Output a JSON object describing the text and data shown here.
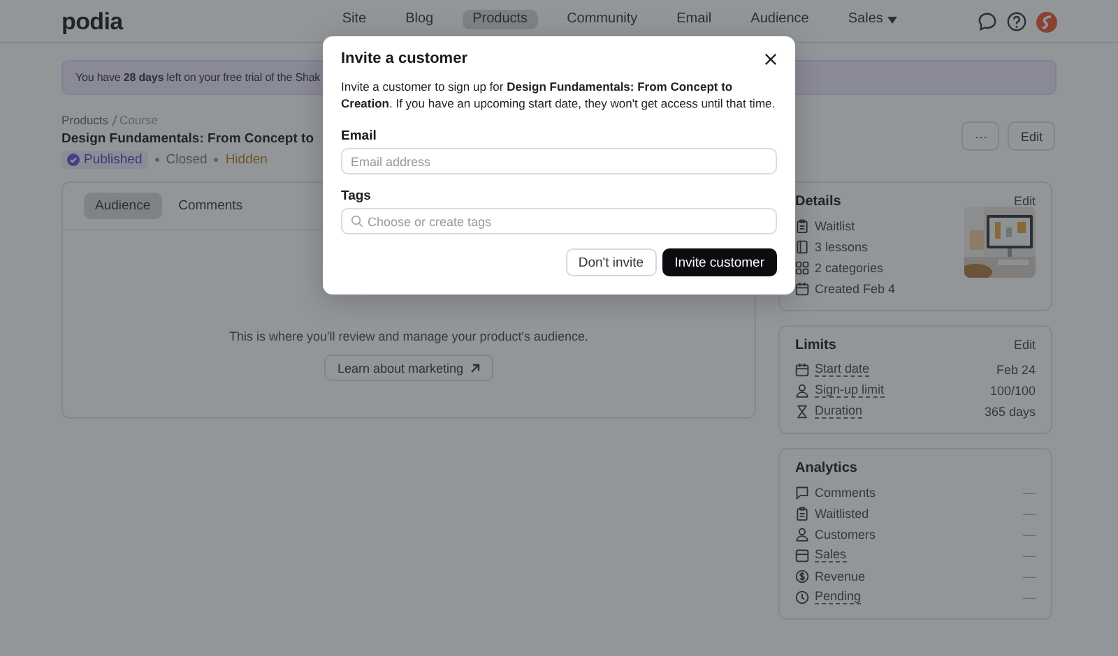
{
  "brand": "podia",
  "nav": [
    {
      "label": "Site",
      "selected": false,
      "has_menu": false
    },
    {
      "label": "Blog",
      "selected": false,
      "has_menu": false
    },
    {
      "label": "Products",
      "selected": true,
      "has_menu": false
    },
    {
      "label": "Community",
      "selected": false,
      "has_menu": false
    },
    {
      "label": "Email",
      "selected": false,
      "has_menu": false
    },
    {
      "label": "Audience",
      "selected": false,
      "has_menu": false
    },
    {
      "label": "Sales",
      "selected": false,
      "has_menu": true
    }
  ],
  "banner": "You have **28 days** left on your free trial of the Shak",
  "breadcrumb": [
    "Products",
    "Course"
  ],
  "title": "Design Fundamentals: From Concept to",
  "statuses": [
    {
      "label": "Published",
      "kind": "badge"
    },
    {
      "label": "Closed",
      "kind": "plain"
    },
    {
      "label": "Hidden",
      "kind": "warning"
    }
  ],
  "actions": [
    "···",
    "Edit"
  ],
  "tabs": [
    {
      "label": "Audience",
      "selected": true
    },
    {
      "label": "Comments",
      "selected": false
    }
  ],
  "empty_state": {
    "text": "This is where you'll review and manage your product's audience.",
    "button": "Learn about marketing"
  },
  "details": {
    "title": "Details",
    "edit": "Edit",
    "items": [
      {
        "kind": "clipboard",
        "label": "Waitlist"
      },
      {
        "kind": "book",
        "label": "3 lessons"
      },
      {
        "kind": "grid",
        "label": "2 categories"
      },
      {
        "kind": "calendar",
        "label": "Created Feb 4"
      }
    ]
  },
  "limits": {
    "title": "Limits",
    "edit": "Edit",
    "items": [
      {
        "kind": "calendar",
        "label": "Start date",
        "value": "Feb 24",
        "underlined": true
      },
      {
        "kind": "person",
        "label": "Sign-up limit",
        "value": "100/100",
        "underlined": true
      },
      {
        "kind": "hourglass",
        "label": "Duration",
        "value": "365 days",
        "underlined": true
      }
    ]
  },
  "analytics": {
    "title": "Analytics",
    "items": [
      {
        "kind": "chat",
        "label": "Comments",
        "value": "—",
        "underlined": false
      },
      {
        "kind": "clipboard",
        "label": "Waitlisted",
        "value": "—",
        "underlined": false
      },
      {
        "kind": "person",
        "label": "Customers",
        "value": "—",
        "underlined": false
      },
      {
        "kind": "box",
        "label": "Sales",
        "value": "—",
        "underlined": true
      },
      {
        "kind": "dollar",
        "label": "Revenue",
        "value": "—",
        "underlined": false
      },
      {
        "kind": "clock",
        "label": "Pending",
        "value": "—",
        "underlined": true
      }
    ]
  },
  "modal": {
    "title": "Invite a customer",
    "text": "Invite a customer to sign up for **Design Fundamentals: From Concept to Creation**. If you have an upcoming start date, they won't get access until that time.",
    "email": {
      "label": "Email",
      "placeholder": "Email address"
    },
    "tags": {
      "label": "Tags",
      "placeholder": "Choose or create tags"
    },
    "buttons": [
      {
        "label": "Don't invite",
        "kind": "secondary"
      },
      {
        "label": "Invite customer",
        "kind": "primary"
      }
    ]
  }
}
